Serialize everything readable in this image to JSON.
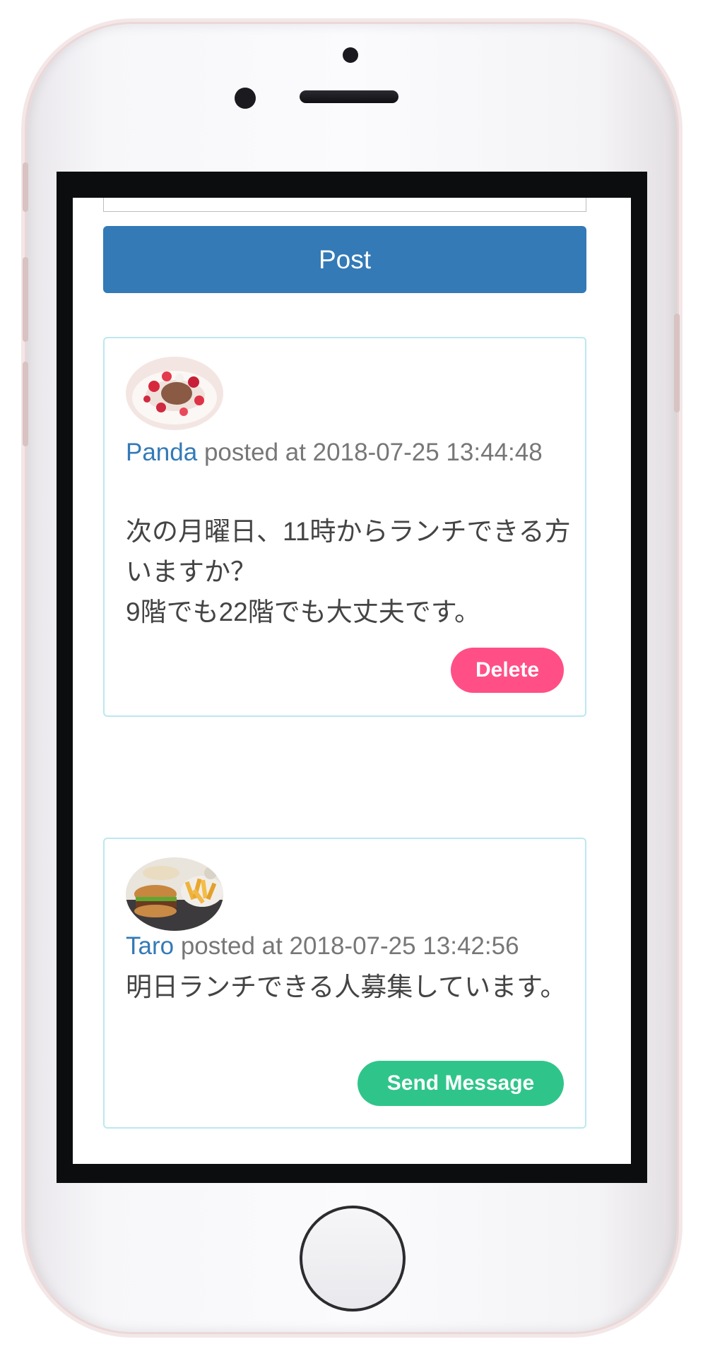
{
  "compose": {
    "post_label": "Post"
  },
  "posts": [
    {
      "username": "Panda",
      "posted_at_text": "posted at 2018-07-25 13:44:48",
      "message": "次の月曜日、11時からランチできる方いますか？\n9階でも22階でも大丈夫です。",
      "action_label": "Delete",
      "action_color": "#ff4f86"
    },
    {
      "username": "Taro",
      "posted_at_text": "posted at 2018-07-25 13:42:56",
      "message": "明日ランチできる人募集しています。",
      "action_label": "Send Message",
      "action_color": "#2fc58a"
    }
  ],
  "theme": {
    "primary": "#337ab7",
    "card_border": "#bce8f1",
    "meta_text": "#777777"
  }
}
